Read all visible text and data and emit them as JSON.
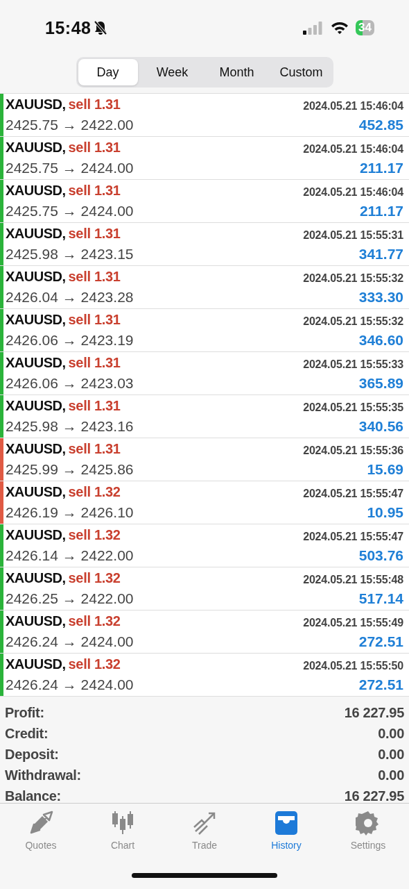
{
  "status_bar": {
    "time": "15:48",
    "battery": "34"
  },
  "period_tabs": [
    {
      "label": "Day",
      "selected": true
    },
    {
      "label": "Week",
      "selected": false
    },
    {
      "label": "Month",
      "selected": false
    },
    {
      "label": "Custom",
      "selected": false
    }
  ],
  "deals": [
    {
      "symbol": "XAUUSD,",
      "side": "sell 1.31",
      "prices": "2425.75 → 2422.00",
      "time": "2024.05.21 15:46:04",
      "profit": "452.85",
      "color": "#2bb33a"
    },
    {
      "symbol": "XAUUSD,",
      "side": "sell 1.31",
      "prices": "2425.75 → 2424.00",
      "time": "2024.05.21 15:46:04",
      "profit": "211.17",
      "color": "#2bb33a"
    },
    {
      "symbol": "XAUUSD,",
      "side": "sell 1.31",
      "prices": "2425.75 → 2424.00",
      "time": "2024.05.21 15:46:04",
      "profit": "211.17",
      "color": "#2bb33a"
    },
    {
      "symbol": "XAUUSD,",
      "side": "sell 1.31",
      "prices": "2425.98 → 2423.15",
      "time": "2024.05.21 15:55:31",
      "profit": "341.77",
      "color": "#2bb33a"
    },
    {
      "symbol": "XAUUSD,",
      "side": "sell 1.31",
      "prices": "2426.04 → 2423.28",
      "time": "2024.05.21 15:55:32",
      "profit": "333.30",
      "color": "#2bb33a"
    },
    {
      "symbol": "XAUUSD,",
      "side": "sell 1.31",
      "prices": "2426.06 → 2423.19",
      "time": "2024.05.21 15:55:32",
      "profit": "346.60",
      "color": "#2bb33a"
    },
    {
      "symbol": "XAUUSD,",
      "side": "sell 1.31",
      "prices": "2426.06 → 2423.03",
      "time": "2024.05.21 15:55:33",
      "profit": "365.89",
      "color": "#2bb33a"
    },
    {
      "symbol": "XAUUSD,",
      "side": "sell 1.31",
      "prices": "2425.98 → 2423.16",
      "time": "2024.05.21 15:55:35",
      "profit": "340.56",
      "color": "#2bb33a"
    },
    {
      "symbol": "XAUUSD,",
      "side": "sell 1.31",
      "prices": "2425.99 → 2425.86",
      "time": "2024.05.21 15:55:36",
      "profit": "15.69",
      "color": "#e05a44"
    },
    {
      "symbol": "XAUUSD,",
      "side": "sell 1.32",
      "prices": "2426.19 → 2426.10",
      "time": "2024.05.21 15:55:47",
      "profit": "10.95",
      "color": "#e05a44"
    },
    {
      "symbol": "XAUUSD,",
      "side": "sell 1.32",
      "prices": "2426.14 → 2422.00",
      "time": "2024.05.21 15:55:47",
      "profit": "503.76",
      "color": "#2bb33a"
    },
    {
      "symbol": "XAUUSD,",
      "side": "sell 1.32",
      "prices": "2426.25 → 2422.00",
      "time": "2024.05.21 15:55:48",
      "profit": "517.14",
      "color": "#2bb33a"
    },
    {
      "symbol": "XAUUSD,",
      "side": "sell 1.32",
      "prices": "2426.24 → 2424.00",
      "time": "2024.05.21 15:55:49",
      "profit": "272.51",
      "color": "#2bb33a"
    },
    {
      "symbol": "XAUUSD,",
      "side": "sell 1.32",
      "prices": "2426.24 → 2424.00",
      "time": "2024.05.21 15:55:50",
      "profit": "272.51",
      "color": "#2bb33a"
    }
  ],
  "summary": [
    {
      "label": "Profit:",
      "value": "16 227.95"
    },
    {
      "label": "Credit:",
      "value": "0.00"
    },
    {
      "label": "Deposit:",
      "value": "0.00"
    },
    {
      "label": "Withdrawal:",
      "value": "0.00"
    },
    {
      "label": "Balance:",
      "value": "16 227.95"
    }
  ],
  "tab_bar": [
    {
      "kind": "quotes",
      "label": "Quotes",
      "selected": false
    },
    {
      "kind": "chart",
      "label": "Chart",
      "selected": false
    },
    {
      "kind": "trade",
      "label": "Trade",
      "selected": false
    },
    {
      "kind": "history",
      "label": "History",
      "selected": true
    },
    {
      "kind": "settings",
      "label": "Settings",
      "selected": false
    }
  ]
}
